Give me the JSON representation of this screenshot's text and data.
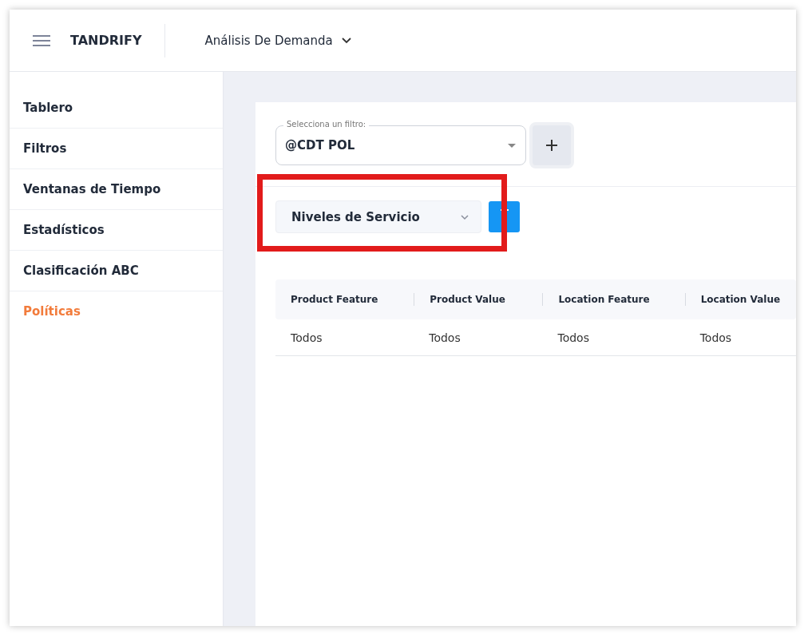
{
  "header": {
    "brand": "TANDRIFY",
    "module": "Análisis De Demanda"
  },
  "sidebar": {
    "items": [
      {
        "label": "Tablero",
        "selected": false
      },
      {
        "label": "Filtros",
        "selected": false
      },
      {
        "label": "Ventanas de Tiempo",
        "selected": false
      },
      {
        "label": "Estadísticos",
        "selected": false
      },
      {
        "label": "Clasificación ABC",
        "selected": false
      },
      {
        "label": "Políticas",
        "selected": true
      }
    ]
  },
  "filter": {
    "label": "Selecciona un filtro:",
    "value": "@CDT POL"
  },
  "policy_select": {
    "value": "Niveles de Servicio"
  },
  "table": {
    "columns": [
      "Product Feature",
      "Product Value",
      "Location Feature",
      "Location Value"
    ],
    "rows": [
      [
        "Todos",
        "Todos",
        "Todos",
        "Todos"
      ]
    ]
  }
}
